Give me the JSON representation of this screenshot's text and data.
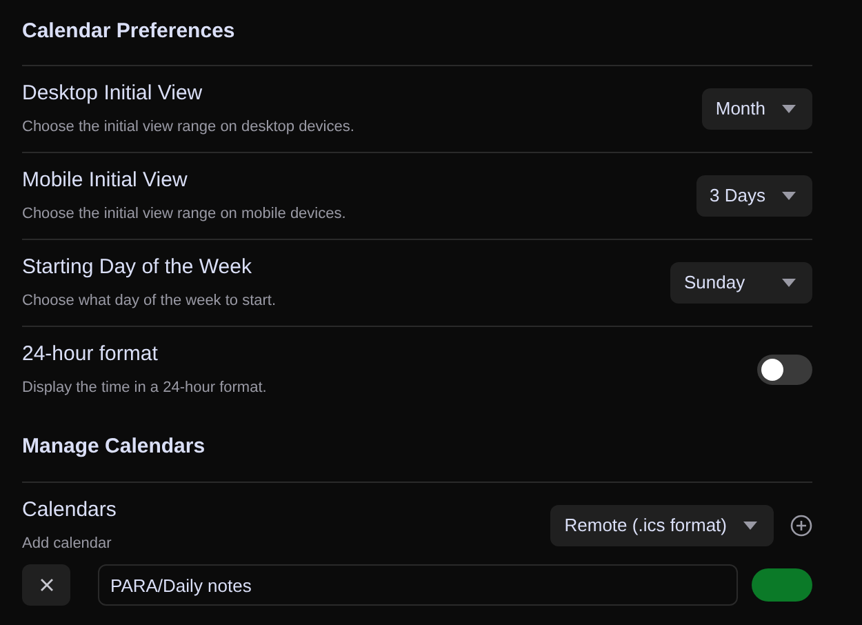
{
  "preferences": {
    "heading": "Calendar Preferences",
    "settings": [
      {
        "kind": "dropdown",
        "name": "Desktop Initial View",
        "description": "Choose the initial view range on desktop devices.",
        "value": "Month"
      },
      {
        "kind": "dropdown",
        "name": "Mobile Initial View",
        "description": "Choose the initial view range on mobile devices.",
        "value": "3 Days"
      },
      {
        "kind": "dropdown",
        "name": "Starting Day of the Week",
        "description": "Choose what day of the week to start.",
        "value": "Sunday"
      },
      {
        "kind": "toggle",
        "name": "24-hour format",
        "description": "Display the time in a 24-hour format.",
        "on": false
      }
    ]
  },
  "manage": {
    "heading": "Manage Calendars",
    "name": "Calendars",
    "description": "Add calendar",
    "source_type": "Remote (.ics format)",
    "calendars": [
      {
        "path": "PARA/Daily notes",
        "color": "#0b7a28"
      }
    ]
  }
}
